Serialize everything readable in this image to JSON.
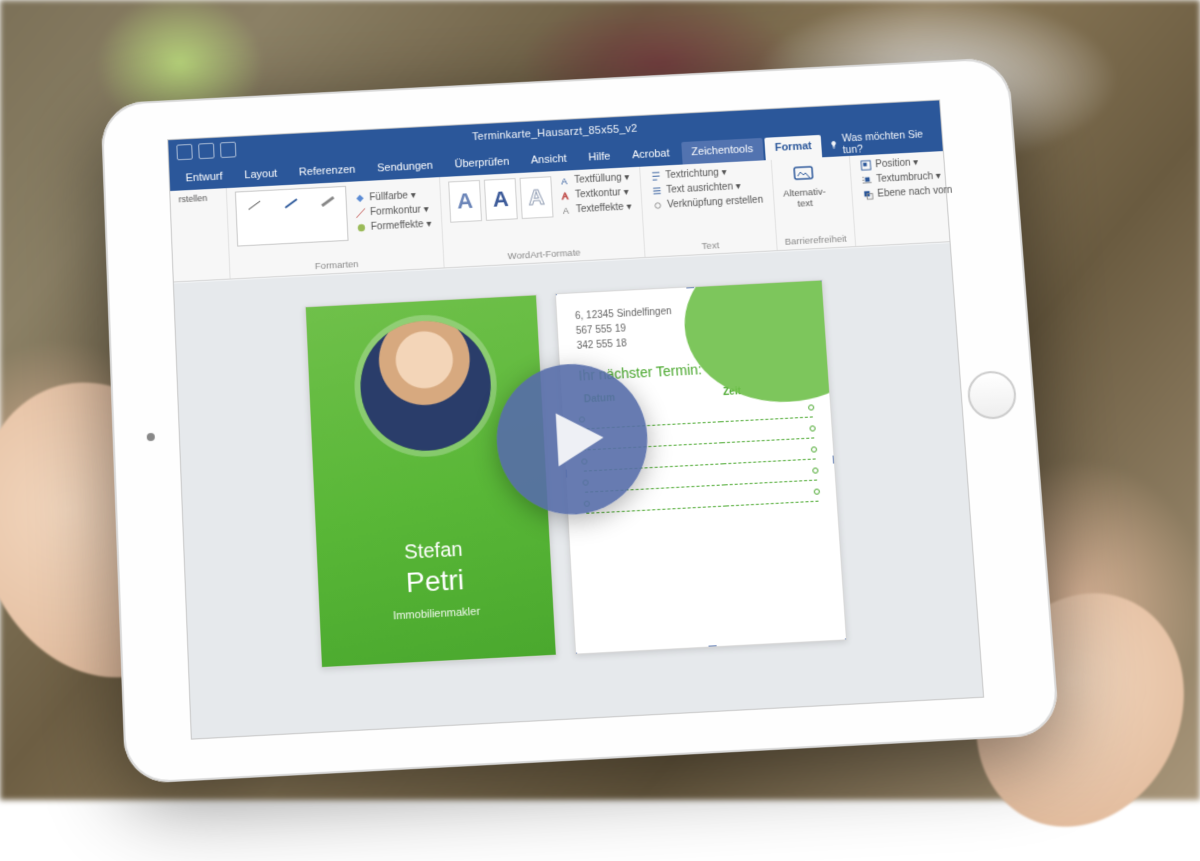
{
  "titlebar": {
    "doc_name": "Terminkarte_Hausarzt_85x55_v2"
  },
  "tabs": {
    "entwurf": "Entwurf",
    "layout": "Layout",
    "referenzen": "Referenzen",
    "sendungen": "Sendungen",
    "ueberpruefen": "Überprüfen",
    "ansicht": "Ansicht",
    "hilfe": "Hilfe",
    "acrobat": "Acrobat",
    "zeichentools": "Zeichentools",
    "format": "Format"
  },
  "search": {
    "placeholder": "Was möchten Sie tun?"
  },
  "ribbon": {
    "formen_erstellen": "rstellen",
    "formarten": "Formarten",
    "fuellfarbe": "Füllfarbe ▾",
    "formkontur": "Formkontur ▾",
    "formeffekte": "Formeffekte ▾",
    "wordart": "WordArt-Formate",
    "textfuellung": "Textfüllung ▾",
    "textkontur": "Textkontur ▾",
    "texteffekte": "Texteffekte ▾",
    "textrichtung": "Textrichtung ▾",
    "text_ausrichten": "Text ausrichten ▾",
    "verknuepfung": "Verknüpfung erstellen",
    "text_group": "Text",
    "barrierefreiheit": "Barrierefreiheit",
    "alternativtext": "Alternativ-\ntext",
    "position": "Position ▾",
    "textumbruch": "Textumbruch ▾",
    "ebene_vorn": "Ebene nach vorn"
  },
  "card": {
    "first_name": "Stefan",
    "last_name": "Petri",
    "role": "Immobilienmakler",
    "addr_street": "6, 12345 Sindelfingen",
    "addr_tel1": "567 555 19",
    "addr_tel2": "342 555 18",
    "next_appt_label": "Ihr nächster Termin:",
    "col_date": "Datum",
    "col_time": "Zeit"
  }
}
